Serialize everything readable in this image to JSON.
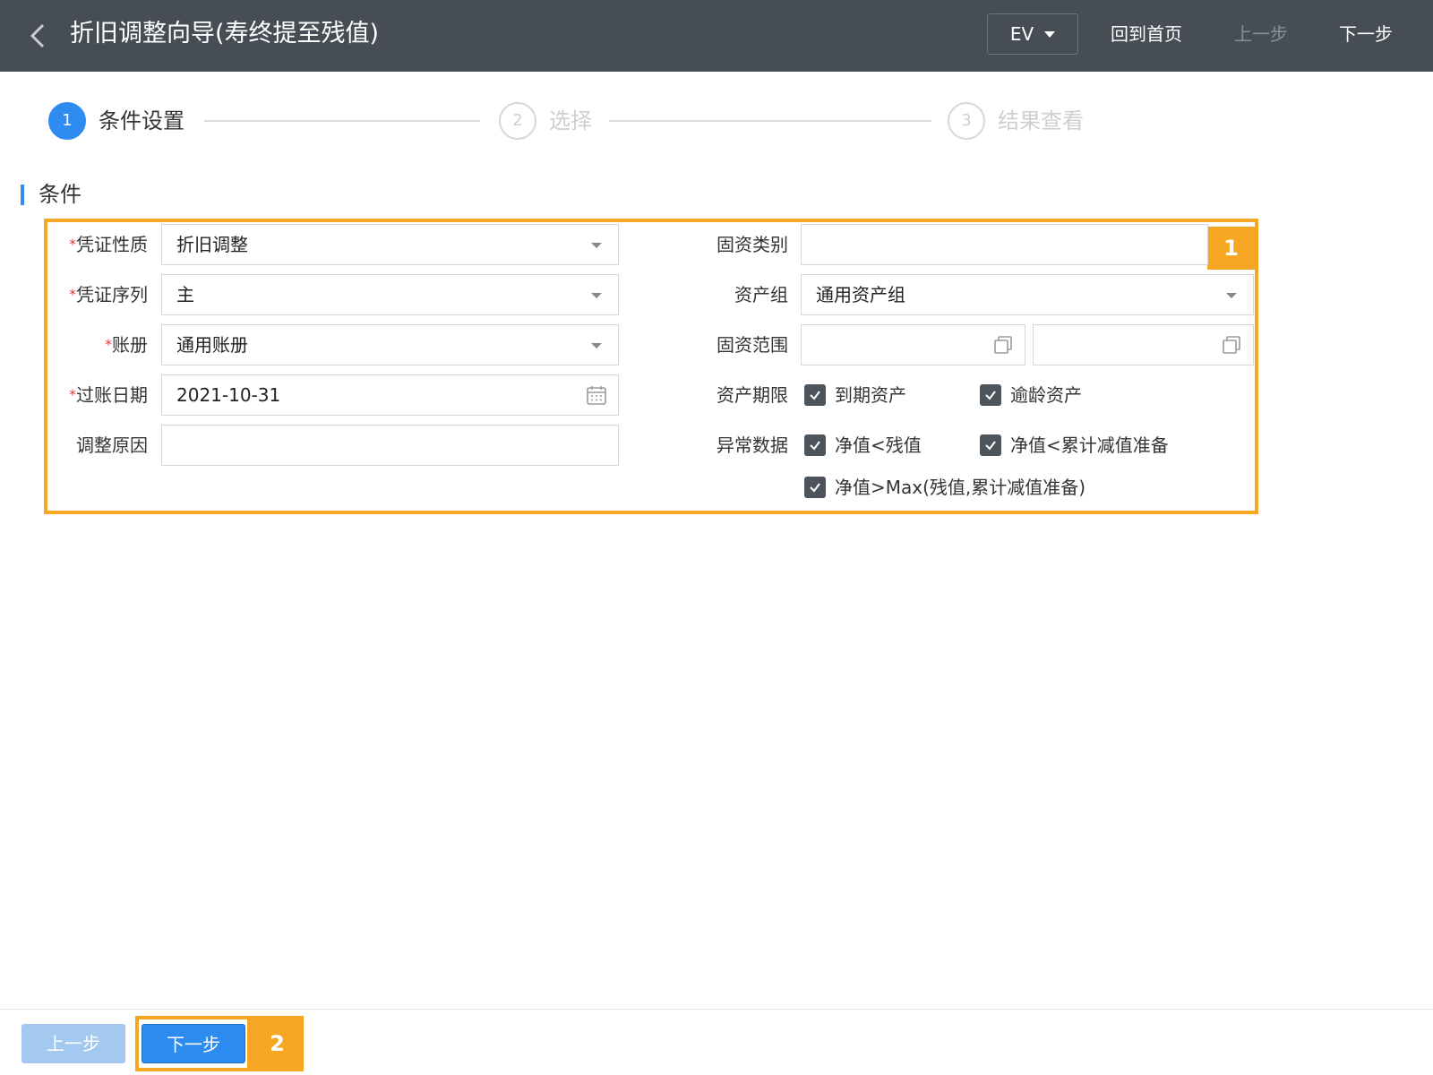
{
  "header": {
    "title": "折旧调整向导(寿终提至残值)",
    "env": "EV",
    "home": "回到首页",
    "prev": "上一步",
    "next": "下一步"
  },
  "steps": [
    {
      "num": "1",
      "label": "条件设置",
      "state": "active"
    },
    {
      "num": "2",
      "label": "选择",
      "state": "inactive"
    },
    {
      "num": "3",
      "label": "结果查看",
      "state": "inactive"
    }
  ],
  "section": {
    "title": "条件"
  },
  "form": {
    "voucher_type": {
      "label": "凭证性质",
      "value": "折旧调整",
      "required": "*"
    },
    "voucher_seq": {
      "label": "凭证序列",
      "value": "主",
      "required": "*"
    },
    "book": {
      "label": "账册",
      "value": "通用账册",
      "required": "*"
    },
    "post_date": {
      "label": "过账日期",
      "value": "2021-10-31",
      "required": "*"
    },
    "adjust_reason": {
      "label": "调整原因",
      "value": ""
    },
    "asset_category": {
      "label": "固资类别",
      "value": ""
    },
    "asset_group": {
      "label": "资产组",
      "value": "通用资产组"
    },
    "asset_range": {
      "label": "固资范围",
      "from": "",
      "to": ""
    },
    "asset_term": {
      "label": "资产期限",
      "options": [
        {
          "label": "到期资产",
          "checked": true
        },
        {
          "label": "逾龄资产",
          "checked": true
        }
      ]
    },
    "abnormal_data": {
      "label": "异常数据",
      "options": [
        {
          "label": "净值<残值",
          "checked": true
        },
        {
          "label": "净值<累计减值准备",
          "checked": true
        },
        {
          "label": "净值>Max(残值,累计减值准备)",
          "checked": true
        }
      ]
    }
  },
  "annotations": {
    "badge1": "1",
    "badge2": "2"
  },
  "footer": {
    "prev": "上一步",
    "next": "下一步"
  },
  "colors": {
    "header_bg": "#474d55",
    "accent": "#2e8cf0",
    "highlight": "#f5a623",
    "checkbox": "#4d545c"
  }
}
